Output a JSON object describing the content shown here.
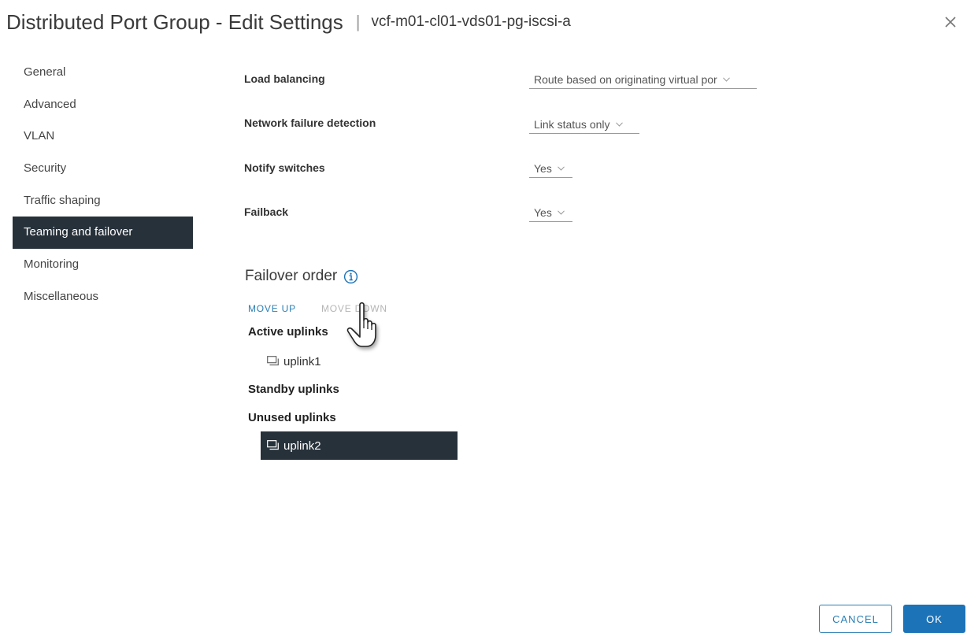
{
  "dialog": {
    "title": "Distributed Port Group - Edit Settings",
    "separator": "|",
    "subtitle": "vcf-m01-cl01-vds01-pg-iscsi-a",
    "close_icon": "close-icon"
  },
  "sidebar": {
    "items": [
      {
        "label": "General"
      },
      {
        "label": "Advanced"
      },
      {
        "label": "VLAN"
      },
      {
        "label": "Security"
      },
      {
        "label": "Traffic shaping"
      },
      {
        "label": "Teaming and failover",
        "active": true
      },
      {
        "label": "Monitoring"
      },
      {
        "label": "Miscellaneous"
      }
    ]
  },
  "settings": {
    "load_balancing": {
      "label": "Load balancing",
      "value": "Route based on originating virtual por"
    },
    "network_failure_detection": {
      "label": "Network failure detection",
      "value": "Link status only"
    },
    "notify_switches": {
      "label": "Notify switches",
      "value": "Yes"
    },
    "failback": {
      "label": "Failback",
      "value": "Yes"
    }
  },
  "failover_order": {
    "title": "Failover order",
    "info_icon": "info-icon",
    "move_up": "MOVE UP",
    "move_down": "MOVE DOWN",
    "active_label": "Active uplinks",
    "active": [
      {
        "name": "uplink1"
      }
    ],
    "standby_label": "Standby uplinks",
    "standby": [],
    "unused_label": "Unused uplinks",
    "unused": [
      {
        "name": "uplink2",
        "selected": true
      }
    ]
  },
  "footer": {
    "cancel": "CANCEL",
    "ok": "OK"
  },
  "colors": {
    "accent": "#1c73b8",
    "link": "#2a7fb4",
    "selected_bg": "#27313a",
    "disabled_text": "#b5b5b5"
  }
}
